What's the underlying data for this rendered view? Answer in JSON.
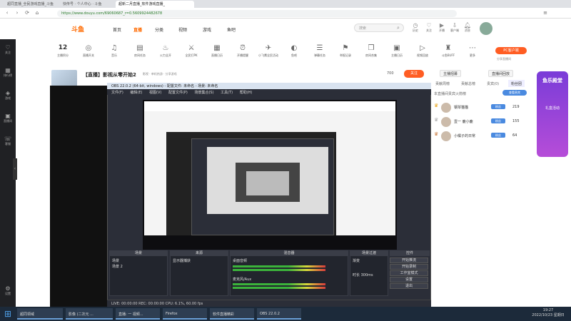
{
  "browser": {
    "tabs": [
      {
        "label": "超同直播_全民游戏直播_斗鱼"
      },
      {
        "label": "快传号 · 个人中心 · 斗鱼"
      },
      {
        "label": "超新二月直播_软件游戏直播_"
      }
    ],
    "url": "https://www.douyu.com/69060687_r=0.5609924482678"
  },
  "header": {
    "logo": "斗鱼",
    "nav": [
      "首页",
      "直播",
      "分类",
      "视频",
      "游戏",
      "鱼吧"
    ],
    "nav_active": "直播",
    "search_placeholder": "搜索",
    "icons": [
      {
        "label": "历史",
        "icon": "clock-icon"
      },
      {
        "label": "关注",
        "icon": "heart-icon"
      },
      {
        "label": "开播",
        "icon": "video-icon"
      },
      {
        "label": "客户端",
        "icon": "download-icon"
      },
      {
        "label": "消息",
        "icon": "bell-icon"
      }
    ]
  },
  "sidebar": {
    "items": [
      {
        "label": "关注",
        "icon": "heart-icon"
      },
      {
        "label": "排行榜",
        "icon": "rank-icon"
      },
      {
        "label": "游戏",
        "icon": "game-icon"
      },
      {
        "label": "直播间",
        "icon": "tv-icon"
      },
      {
        "label": "客服",
        "icon": "service-icon"
      },
      {
        "label": "设置",
        "icon": "gear-icon"
      }
    ]
  },
  "categories": {
    "level": "12",
    "items": [
      "主播积分",
      "直播开关",
      "音乐",
      "房间任务",
      "火力全开",
      "全民打PK",
      "直播日历",
      "开播提醒",
      "小飞鹰全民活动",
      "鱼吧",
      "弹幕任务",
      "举报记录",
      "房间合集",
      "主播日历",
      "视频回放",
      "斗鱼BUFF",
      "更多"
    ],
    "pc_button": "PC客户端",
    "pc_sub": "分享直播间"
  },
  "stream": {
    "title": "【直播】影视从零开始2",
    "meta": "影视 · 单机热游 · 分享游戏",
    "follow_label": "关注",
    "follow_count": "700",
    "tag": "V视频"
  },
  "obs": {
    "title": "OBS 22.0.2 (64-bit, windows) - 配置文件: 未命名 - 场景: 未命名",
    "menu": [
      "文件(F)",
      "编辑(E)",
      "视图(V)",
      "配置文件(P)",
      "场景集合(S)",
      "工具(T)",
      "帮助(H)"
    ],
    "docks": [
      {
        "title": "场景",
        "items": [
          "场景",
          "场景 2"
        ]
      },
      {
        "title": "来源",
        "items": [
          "显示器捕获"
        ]
      },
      {
        "title": "混音器",
        "items": [
          "桌面音频",
          "麦克风/Aux"
        ]
      },
      {
        "title": "场景过渡",
        "items": [
          "渐变",
          "时长 300ms"
        ]
      },
      {
        "title": "控件",
        "items": []
      }
    ],
    "controls": [
      "开始推流",
      "开始录制",
      "工作室模式",
      "设置",
      "退出"
    ],
    "status": "LIVE: 00:00:00    REC: 00:00:00    CPU: 6.1%, 60.00 fps"
  },
  "right": {
    "buttons": [
      "主播招募",
      "直播间回放"
    ],
    "tabs": [
      "贡献周榜",
      "贡献总榜",
      "贵宾(0)",
      "粉丝团"
    ],
    "tab_active": "粉丝团",
    "rank_header": "本直播间贵宾火箭榜",
    "rank_action": "查看贵宾",
    "ranks": [
      {
        "name": "钢琴猫猫",
        "badge": "粉丝",
        "score": "219"
      },
      {
        "name": "壹一 鹿小鹿",
        "badge": "粉丝",
        "score": "155"
      },
      {
        "name": "小橘子的日常",
        "badge": "粉丝",
        "score": "64"
      }
    ],
    "promo_title": "鱼乐殿堂",
    "promo_sub": "礼盒活动"
  },
  "taskbar": {
    "items": [
      "超同领域",
      "影像 (二次元 ...",
      "直播: 一 视频...",
      "Firefox",
      "软件直播精彩",
      "OBS 22.0.2"
    ],
    "time": "19:27",
    "date": "2022/10/23 星期日"
  }
}
